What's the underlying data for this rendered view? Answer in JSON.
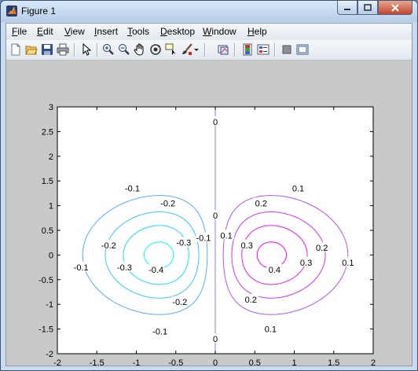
{
  "window": {
    "title": "Figure 1"
  },
  "menu": {
    "items": [
      {
        "label": "File",
        "key": "F"
      },
      {
        "label": "Edit",
        "key": "E"
      },
      {
        "label": "View",
        "key": "V"
      },
      {
        "label": "Insert",
        "key": "I"
      },
      {
        "label": "Tools",
        "key": "T"
      },
      {
        "label": "Desktop",
        "key": "D"
      },
      {
        "label": "Window",
        "key": "W"
      },
      {
        "label": "Help",
        "key": "H"
      }
    ]
  },
  "toolbar": {
    "icons": [
      "new-figure-icon",
      "open-file-icon",
      "save-icon",
      "print-icon",
      "edit-plot-arrow-icon",
      "zoom-in-icon",
      "zoom-out-icon",
      "pan-hand-icon",
      "rotate-3d-icon",
      "data-cursor-icon",
      "brush-icon",
      "brush-dropdown-icon",
      "link-plot-icon",
      "colorbar-icon",
      "legend-icon",
      "hide-plot-tools-icon",
      "show-plot-tools-icon"
    ]
  },
  "chart_data": {
    "type": "contour",
    "title": "",
    "xlabel": "",
    "ylabel": "",
    "xlim": [
      -2,
      2
    ],
    "ylim": [
      -2,
      3
    ],
    "xticks": [
      "-2",
      "-1.5",
      "-1",
      "-0.5",
      "0",
      "0.5",
      "1",
      "1.5",
      "2"
    ],
    "yticks": [
      "-2",
      "-1.5",
      "-1",
      "-0.5",
      "0",
      "0.5",
      "1",
      "1.5",
      "2",
      "2.5",
      "3"
    ],
    "levels": [
      {
        "value": -0.4,
        "color": "#00ffff"
      },
      {
        "value": -0.3,
        "color": "#1ad9ff"
      },
      {
        "value": -0.2,
        "color": "#33c7ff"
      },
      {
        "value": -0.1,
        "color": "#55aaff"
      },
      {
        "value": 0,
        "color": "#7f7fff"
      },
      {
        "value": 0.1,
        "color": "#aa55ff"
      },
      {
        "value": 0.2,
        "color": "#cc33ff"
      },
      {
        "value": 0.3,
        "color": "#e61aff"
      },
      {
        "value": 0.4,
        "color": "#ff00ff"
      }
    ],
    "contour_labels": [
      {
        "text": "-0.1",
        "x": -1.05,
        "y": 1.35
      },
      {
        "text": "-0.2",
        "x": -0.6,
        "y": 1.05
      },
      {
        "text": "-0.3",
        "x": -0.4,
        "y": 0.25
      },
      {
        "text": "-0.1",
        "x": -0.15,
        "y": 0.35
      },
      {
        "text": "-0.2",
        "x": -1.35,
        "y": 0.2
      },
      {
        "text": "-0.1",
        "x": -1.7,
        "y": -0.25
      },
      {
        "text": "-0.3",
        "x": -1.15,
        "y": -0.25
      },
      {
        "text": "-0.4",
        "x": -0.75,
        "y": -0.3
      },
      {
        "text": "-0.2",
        "x": -0.45,
        "y": -0.95
      },
      {
        "text": "-0.1",
        "x": -0.7,
        "y": -1.55
      },
      {
        "text": "0",
        "x": 0,
        "y": 2.7
      },
      {
        "text": "0",
        "x": 0,
        "y": 0.8
      },
      {
        "text": "0",
        "x": 0,
        "y": -1.7
      },
      {
        "text": "0.1",
        "x": 1.05,
        "y": 1.35
      },
      {
        "text": "0.2",
        "x": 0.58,
        "y": 1.05
      },
      {
        "text": "0.1",
        "x": 0.14,
        "y": 0.4
      },
      {
        "text": "0.3",
        "x": 0.4,
        "y": 0.2
      },
      {
        "text": "0.2",
        "x": 1.35,
        "y": 0.15
      },
      {
        "text": "0.1",
        "x": 1.68,
        "y": -0.15
      },
      {
        "text": "0.3",
        "x": 1.15,
        "y": -0.15
      },
      {
        "text": "0.4",
        "x": 0.75,
        "y": -0.3
      },
      {
        "text": "0.2",
        "x": 0.45,
        "y": -0.9
      },
      {
        "text": "0.1",
        "x": 0.7,
        "y": -1.5
      }
    ]
  }
}
